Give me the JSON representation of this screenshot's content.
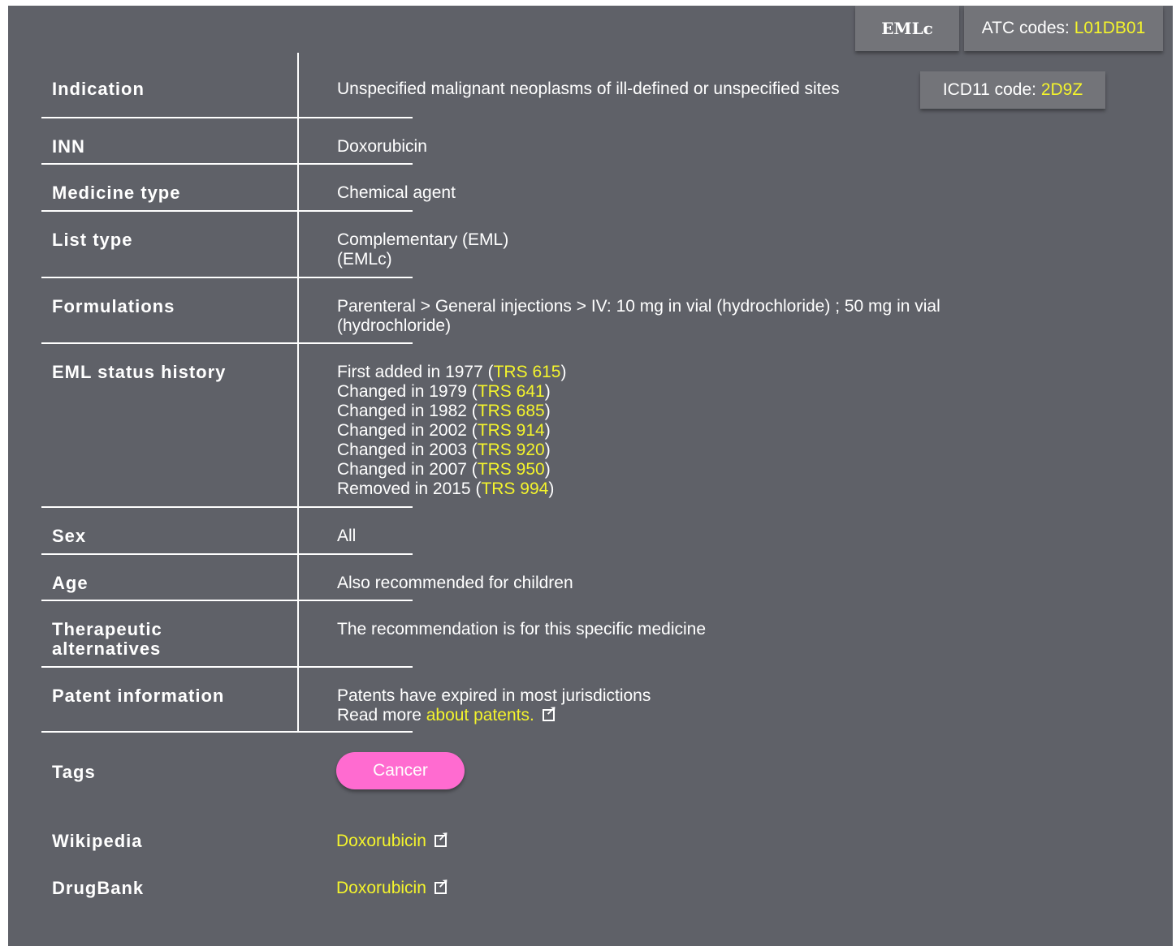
{
  "header": {
    "eml_tab": "EMLc",
    "atc_label": "ATC codes: ",
    "atc_code": "L01DB01"
  },
  "rows": {
    "indication": {
      "label": "Indication",
      "value": "Unspecified malignant neoplasms of ill-defined or unspecified sites",
      "icd_label": "ICD11 code: ",
      "icd_code": "2D9Z"
    },
    "inn": {
      "label": "INN",
      "value": "Doxorubicin"
    },
    "medicine_type": {
      "label": "Medicine type",
      "value": "Chemical agent"
    },
    "list_type": {
      "label": "List type",
      "line1": "Complementary (EML)",
      "line2": "(EMLc)"
    },
    "formulations": {
      "label": "Formulations",
      "line1": "Parenteral > General injections > IV: 10 mg in vial (hydrochloride) ; 50 mg in vial",
      "line2": "(hydrochloride)"
    },
    "eml_status": {
      "label": "EML status history",
      "items": [
        {
          "text": "First added in 1977 (",
          "link": "TRS 615",
          "close": ")"
        },
        {
          "text": "Changed in 1979 (",
          "link": "TRS 641",
          "close": ")"
        },
        {
          "text": "Changed in 1982 (",
          "link": "TRS 685",
          "close": ")"
        },
        {
          "text": "Changed in 2002 (",
          "link": "TRS 914",
          "close": ")"
        },
        {
          "text": "Changed in 2003 (",
          "link": "TRS 920",
          "close": ")"
        },
        {
          "text": "Changed in 2007 (",
          "link": "TRS 950",
          "close": ")"
        },
        {
          "text": "Removed in 2015 (",
          "link": "TRS 994",
          "close": ")"
        }
      ]
    },
    "sex": {
      "label": "Sex",
      "value": "All"
    },
    "age": {
      "label": "Age",
      "value": "Also recommended for children"
    },
    "therapeutic": {
      "label_line1": "Therapeutic",
      "label_line2": "alternatives",
      "value": "The recommendation is for this specific medicine"
    },
    "patent": {
      "label": "Patent information",
      "line1": "Patents have expired in most jurisdictions",
      "line2_text": "Read more ",
      "line2_link": "about patents."
    },
    "tags": {
      "label": "Tags",
      "tag": "Cancer"
    },
    "wikipedia": {
      "label": "Wikipedia",
      "link": "Doxorubicin"
    },
    "drugbank": {
      "label": "DrugBank",
      "link": "Doxorubicin"
    }
  },
  "icons": [
    "external-link-icon"
  ],
  "colors": {
    "background": "#5f6168",
    "link": "#f4f42c",
    "tag": "#ff6bd0",
    "tab": "#737479"
  }
}
